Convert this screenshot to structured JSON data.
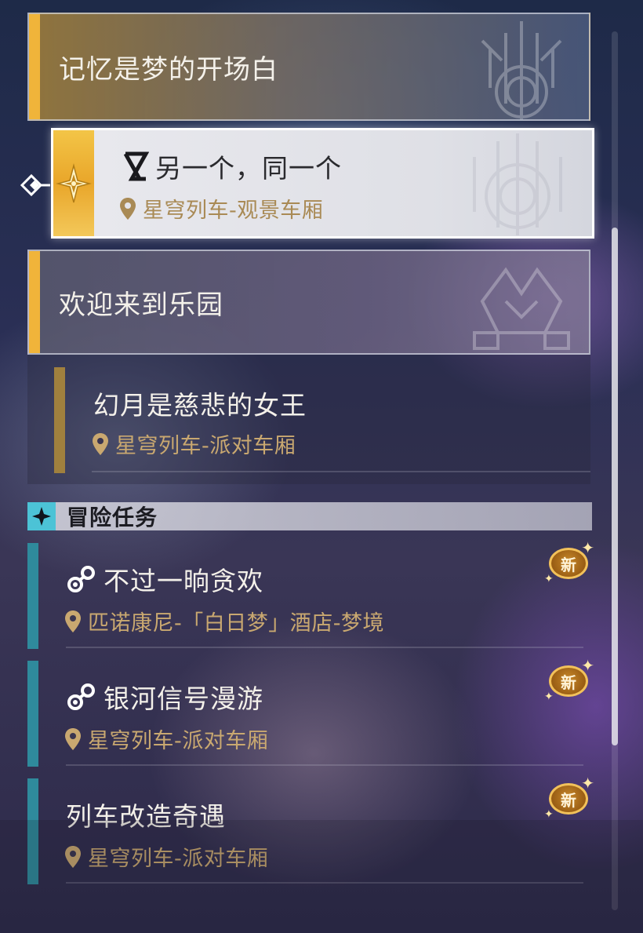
{
  "quest_list": {
    "chapter_1": {
      "title": "记忆是梦的开场白"
    },
    "selected_quest": {
      "title": "另一个，同一个",
      "location": "星穹列车-观景车厢"
    },
    "chapter_2": {
      "title": "欢迎来到乐园"
    },
    "chapter_2_quest": {
      "title": "幻月是慈悲的女王",
      "location": "星穹列车-派对车厢"
    },
    "adventure_section": {
      "label": "冒险任务"
    },
    "adventure_quests": [
      {
        "title": "不过一晌贪欢",
        "location": "匹诺康尼-「白日梦」酒店-梦境",
        "badge": "新"
      },
      {
        "title": "银河信号漫游",
        "location": "星穹列车-派对车厢",
        "badge": "新"
      },
      {
        "title": "列车改造奇遇",
        "location": "星穹列车-派对车厢",
        "badge": "新"
      }
    ]
  },
  "icons": {
    "mission_type": "hourglass-icon",
    "location": "map-pin-icon",
    "adventure": "molecule-icon",
    "section": "four-point-star-icon"
  },
  "colors": {
    "gold_accent": "#f0b43a",
    "teal_accent": "#2f8a9c",
    "location_text": "#c9a870",
    "section_icon_bg": "#4cc3d6"
  }
}
